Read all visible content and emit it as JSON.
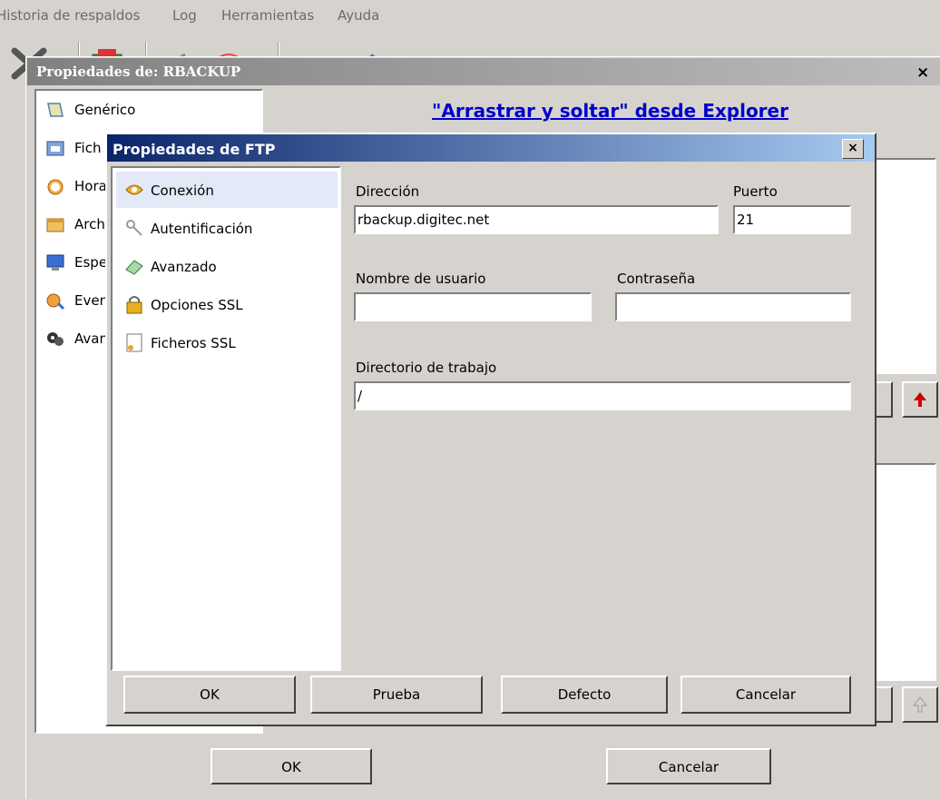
{
  "menu": [
    "Historia de respaldos",
    "Log",
    "Herramientas",
    "Ayuda"
  ],
  "rbackup_dialog": {
    "title": "Propiedades de: RBACKUP",
    "close": "×",
    "drag_drop_link": "\"Arrastrar y soltar\" desde Explorer",
    "list_items": [
      "Genérico",
      "Fich",
      "Hora",
      "Arch",
      "Espe",
      "Even",
      "Avan"
    ],
    "ok_label": "OK",
    "cancel_label": "Cancelar"
  },
  "ftp_dialog": {
    "title": "Propiedades de FTP",
    "close": "×",
    "sections": [
      "Conexión",
      "Autentificación",
      "Avanzado",
      "Opciones SSL",
      "Ficheros SSL"
    ],
    "selected_section": "Conexión",
    "address_label": "Dirección",
    "address_value": "rbackup.digitec.net",
    "port_label": "Puerto",
    "port_value": "21",
    "username_label": "Nombre de usuario",
    "username_value": "",
    "password_label": "Contraseña",
    "password_value": "",
    "workdir_label": "Directorio de trabajo",
    "workdir_value": "/",
    "buttons": {
      "ok": "OK",
      "test": "Prueba",
      "default": "Defecto",
      "cancel": "Cancelar"
    }
  },
  "colors": {
    "ftp_title_start": "#0a246a",
    "ftp_title_end": "#a6caf0",
    "link": "#0000cc",
    "window_bg": "#d6d3ce"
  }
}
